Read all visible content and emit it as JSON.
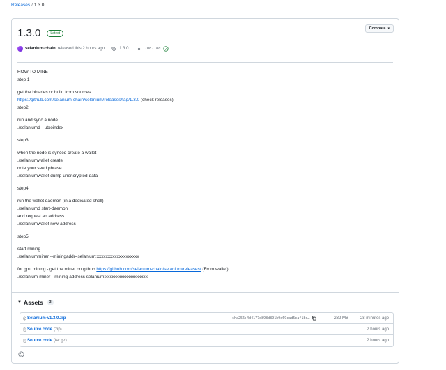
{
  "breadcrumb": {
    "parent": "Releases",
    "separator": "/",
    "current": "1.3.0"
  },
  "release": {
    "title": "1.3.0",
    "badge": "Latest",
    "compare_label": "Compare",
    "author": "selanium-chain",
    "released_text": "released this 2 hours ago",
    "tag": "1.3.0",
    "commit": "7d8718d"
  },
  "notes": {
    "p1_line1": "HOW TO MINE",
    "p1_line2": "step 1",
    "p2_line1": "get the binaries or build from sources",
    "p2_link": "https://github.com/selanium-chain/selanium/releases/tag/1.3.0",
    "p2_after_link": " (check releases)",
    "p2_line3": "step2",
    "p3_line1": "run and sync a node",
    "p3_line2": "./selaniumd --utxoindex",
    "p4": "step3",
    "p5_line1": "when the node is synced create a wallet",
    "p5_line2": "./selaniumwallet create",
    "p5_line3": "note your seed phrase",
    "p5_line4": "./selaniumwallet dump-unencrypted-data",
    "p6": "step4",
    "p7_line1": "run the wallet daemon (in a dedicated shell)",
    "p7_line2": "./selaniumd start-daemon",
    "p7_line3": "and request an address",
    "p7_line4": "./selaniumwallet new-address",
    "p8": "step5",
    "p9_line1": "start mining",
    "p9_line2": "./selaniumminer --miningaddr=selanium:xxxxxxxxxxxxxxxxxxx",
    "p10_before_link": "for gpu mining - get the miner on github ",
    "p10_link": "https://github.com/selanium-chain/selanium/releases/",
    "p10_after_link": " (From wallet)",
    "p10_line2": "./selanium-miner --mining-address selanium:xxxxxxxxxxxxxxxxxxx"
  },
  "assets": {
    "heading": "Assets",
    "count": "3",
    "items": [
      {
        "name": "Selanium-v1.3.0.zip",
        "sub": "",
        "hash": "sha256:4d4177d898d891b9d69cad5caf18d…",
        "size": "232 MB",
        "time": "28 minutes ago"
      },
      {
        "name": "Source code",
        "sub": "(zip)",
        "hash": "",
        "size": "",
        "time": "2 hours ago"
      },
      {
        "name": "Source code",
        "sub": "(tar.gz)",
        "hash": "",
        "size": "",
        "time": "2 hours ago"
      }
    ]
  },
  "icons": {
    "accent": "#0969da",
    "success": "#1a7f37",
    "border": "#d0d7de",
    "muted": "#656d76"
  }
}
